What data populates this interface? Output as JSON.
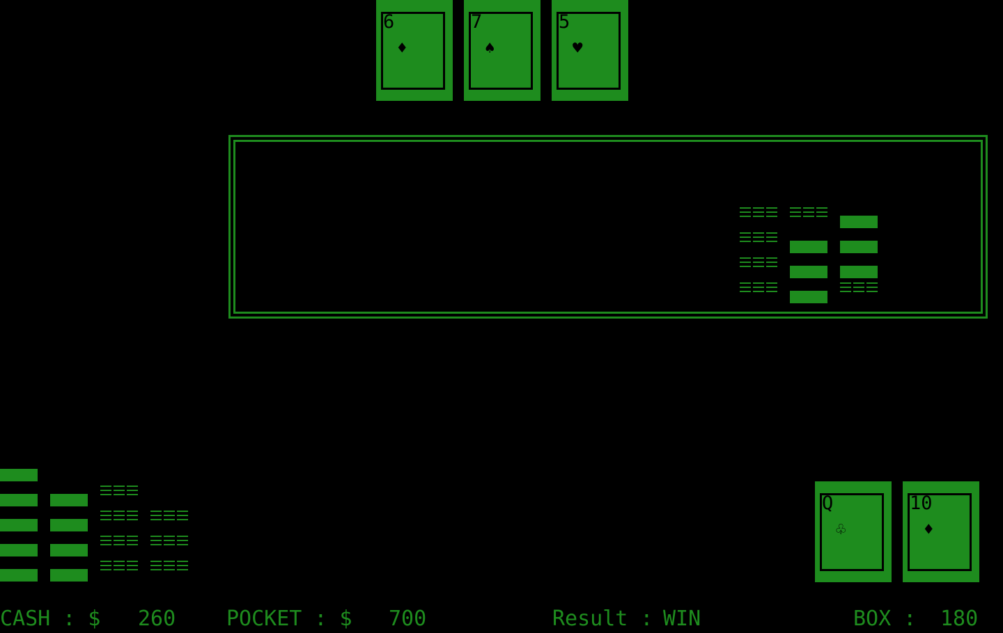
{
  "dealer_cards": [
    {
      "rank": "6",
      "suit": "♦",
      "suit_name": "diamonds"
    },
    {
      "rank": "7",
      "suit": "♠",
      "suit_name": "spades"
    },
    {
      "rank": "5",
      "suit": "♥",
      "suit_name": "hearts"
    }
  ],
  "player_cards": [
    {
      "rank": "Q",
      "suit": "♧",
      "suit_name": "clubs"
    },
    {
      "rank": "10",
      "suit": "♦",
      "suit_name": "diamonds"
    }
  ],
  "status": {
    "cash_label": "CASH : $",
    "cash_value": "260",
    "pocket_label": "POCKET : $",
    "pocket_value": "700",
    "result_label": "Result :",
    "result_value": "WIN",
    "box_label": "BOX :",
    "box_value": "180"
  },
  "colors": {
    "primary": "#1e8c1e",
    "background": "#000000"
  }
}
